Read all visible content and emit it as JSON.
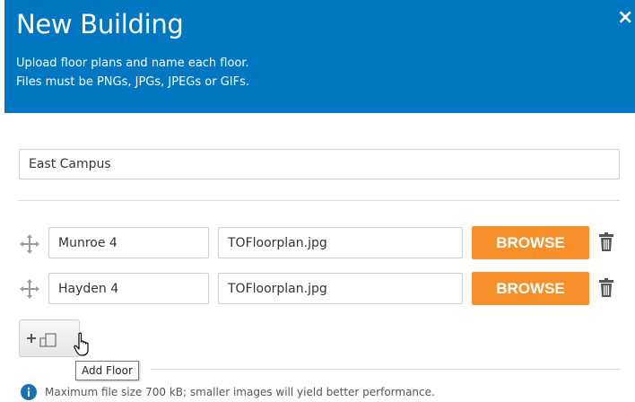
{
  "header": {
    "title": "New Building",
    "subtitle_line1": "Upload floor plans and name each floor.",
    "subtitle_line2": "Files must be PNGs, JPGs, JPEGs or GIFs.",
    "close_icon": "close-icon",
    "close_label": "×",
    "background_color": "#0077c0"
  },
  "building": {
    "name_value": "East Campus"
  },
  "floors": [
    {
      "name_value": "Munroe 4",
      "file_value": "TOFloorplan.jpg",
      "browse_label": "BROWSE",
      "drag_icon": "drag-move-icon",
      "delete_icon": "trash-icon"
    },
    {
      "name_value": "Hayden 4",
      "file_value": "TOFloorplan.jpg",
      "browse_label": "BROWSE",
      "drag_icon": "drag-move-icon",
      "delete_icon": "trash-icon"
    }
  ],
  "add_floor": {
    "icon": "add-floor-icon",
    "tooltip": "Add Floor"
  },
  "footer": {
    "info_icon": "info-icon",
    "note": "Maximum file size 700 kB; smaller images will yield better performance."
  },
  "colors": {
    "accent": "#0077c0",
    "browse": "#f7902b"
  }
}
